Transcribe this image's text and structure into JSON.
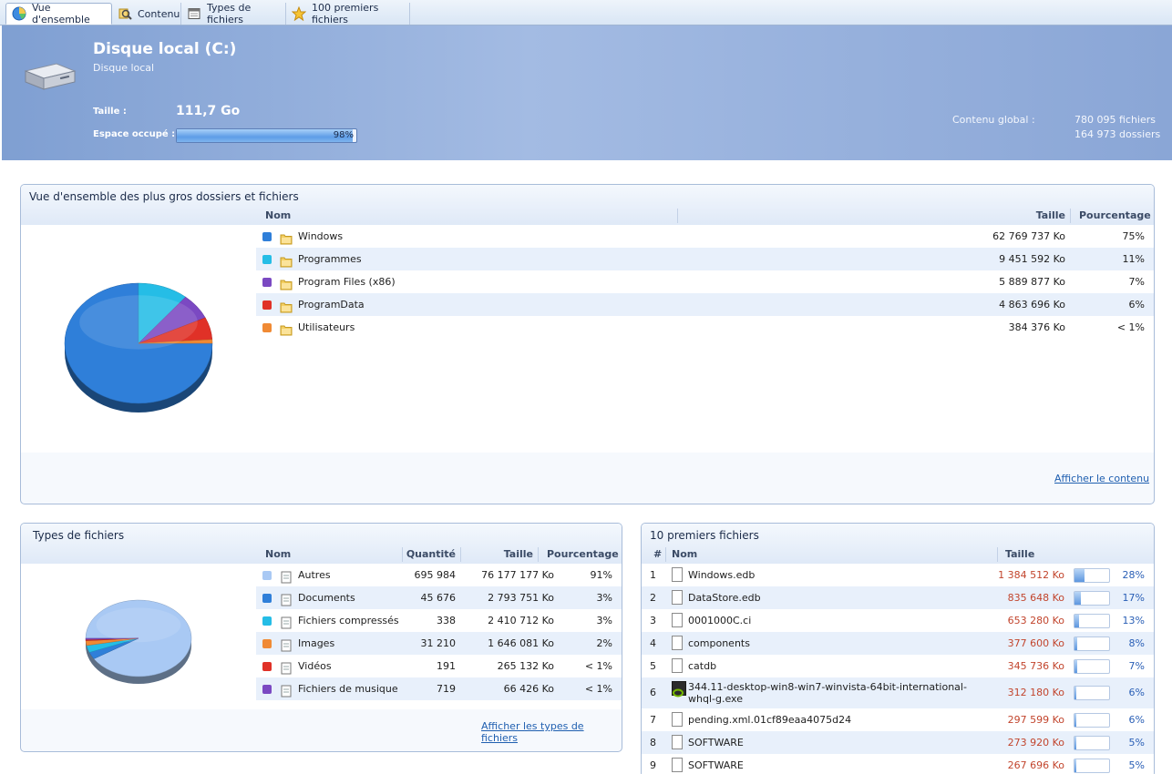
{
  "tabs": [
    {
      "label": "Vue d'ensemble",
      "icon": "pie-chart-icon",
      "active": true
    },
    {
      "label": "Contenu",
      "icon": "magnifier-icon",
      "active": false
    },
    {
      "label": "Types de fichiers",
      "icon": "window-icon",
      "active": false
    },
    {
      "label": "100 premiers fichiers",
      "icon": "star-icon",
      "active": false
    }
  ],
  "header": {
    "title": "Disque local (C:)",
    "subtitle": "Disque local",
    "size_label": "Taille :",
    "size_value": "111,7 Go",
    "used_label": "Espace occupé :",
    "used_percent_text": "98%",
    "used_fraction": 0.98,
    "global_label": "Contenu global :",
    "files_count": "780 095 fichiers",
    "dirs_count": "164 973 dossiers"
  },
  "overview": {
    "title": "Vue d'ensemble des plus gros dossiers et fichiers",
    "col_name": "Nom",
    "col_size": "Taille",
    "col_pct": "Pourcentage",
    "rows": [
      {
        "name": "Windows",
        "size": "62 769 737 Ko",
        "pct": "75%",
        "color": "#2f7fd9",
        "value": 75
      },
      {
        "name": "Programmes",
        "size": "9 451 592 Ko",
        "pct": "11%",
        "color": "#25bde6",
        "value": 11
      },
      {
        "name": "Program Files (x86)",
        "size": "5 889 877 Ko",
        "pct": "7%",
        "color": "#7b49c2",
        "value": 7
      },
      {
        "name": "ProgramData",
        "size": "4 863 696 Ko",
        "pct": "6%",
        "color": "#e03127",
        "value": 6
      },
      {
        "name": "Utilisateurs",
        "size": "384 376 Ko",
        "pct": "< 1%",
        "color": "#f08a34",
        "value": 1
      }
    ],
    "link": "Afficher le contenu"
  },
  "types": {
    "title": "Types de fichiers",
    "col_name": "Nom",
    "col_qty": "Quantité",
    "col_size": "Taille",
    "col_pct": "Pourcentage",
    "rows": [
      {
        "name": "Autres",
        "qty": "695 984",
        "size": "76 177 177 Ko",
        "pct": "91%",
        "color": "#a9c9f4",
        "value": 91
      },
      {
        "name": "Documents",
        "qty": "45 676",
        "size": "2 793 751 Ko",
        "pct": "3%",
        "color": "#2f7fd9",
        "value": 3
      },
      {
        "name": "Fichiers compressés",
        "qty": "338",
        "size": "2 410 712 Ko",
        "pct": "3%",
        "color": "#25bde6",
        "value": 3
      },
      {
        "name": "Images",
        "qty": "31 210",
        "size": "1 646 081 Ko",
        "pct": "2%",
        "color": "#f08a34",
        "value": 2
      },
      {
        "name": "Vidéos",
        "qty": "191",
        "size": "265 132 Ko",
        "pct": "< 1%",
        "color": "#e03127",
        "value": 0.5
      },
      {
        "name": "Fichiers de musique",
        "qty": "719",
        "size": "66 426 Ko",
        "pct": "< 1%",
        "color": "#7b49c2",
        "value": 0.5
      }
    ],
    "link": "Afficher les types de fichiers"
  },
  "top_files": {
    "title": "10 premiers fichiers",
    "col_num": "#",
    "col_name": "Nom",
    "col_size": "Taille",
    "rows": [
      {
        "num": "1",
        "name": "Windows.edb",
        "size": "1 384 512 Ko",
        "pct": "28%",
        "fraction": 0.28
      },
      {
        "num": "2",
        "name": "DataStore.edb",
        "size": "835 648 Ko",
        "pct": "17%",
        "fraction": 0.17
      },
      {
        "num": "3",
        "name": "0001000C.ci",
        "size": "653 280 Ko",
        "pct": "13%",
        "fraction": 0.13
      },
      {
        "num": "4",
        "name": "components",
        "size": "377 600 Ko",
        "pct": "8%",
        "fraction": 0.08
      },
      {
        "num": "5",
        "name": "catdb",
        "size": "345 736 Ko",
        "pct": "7%",
        "fraction": 0.07
      },
      {
        "num": "6",
        "name": "344.11-desktop-win8-win7-winvista-64bit-international-whql-g.exe",
        "size": "312 180 Ko",
        "pct": "6%",
        "fraction": 0.06
      },
      {
        "num": "7",
        "name": "pending.xml.01cf89eaa4075d24",
        "size": "297 599 Ko",
        "pct": "6%",
        "fraction": 0.06
      },
      {
        "num": "8",
        "name": "SOFTWARE",
        "size": "273 920 Ko",
        "pct": "5%",
        "fraction": 0.05
      },
      {
        "num": "9",
        "name": "SOFTWARE",
        "size": "267 696 Ko",
        "pct": "5%",
        "fraction": 0.05
      }
    ]
  }
}
